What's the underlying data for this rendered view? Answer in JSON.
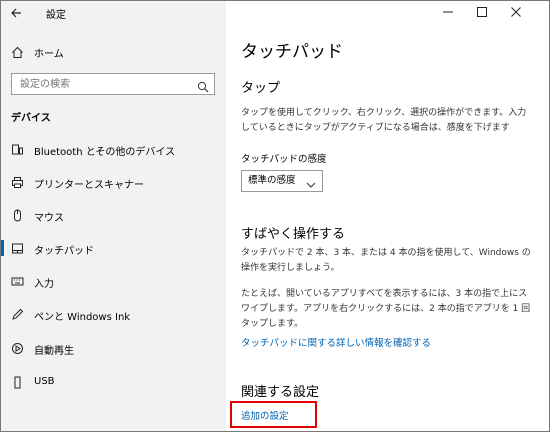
{
  "window": {
    "title": "設定",
    "controls": {
      "minimize": "—",
      "maximize": "☐",
      "close": "✕"
    }
  },
  "sidebar": {
    "home_label": "ホーム",
    "search_placeholder": "設定の検索",
    "section_label": "デバイス",
    "items": [
      {
        "label": "Bluetooth とその他のデバイス",
        "icon": "bluetooth-devices-icon"
      },
      {
        "label": "プリンターとスキャナー",
        "icon": "printer-icon"
      },
      {
        "label": "マウス",
        "icon": "mouse-icon"
      },
      {
        "label": "タッチパッド",
        "icon": "touchpad-icon",
        "active": true
      },
      {
        "label": "入力",
        "icon": "keyboard-icon"
      },
      {
        "label": "ペンと Windows Ink",
        "icon": "pen-icon"
      },
      {
        "label": "自動再生",
        "icon": "autoplay-icon"
      },
      {
        "label": "USB",
        "icon": "usb-icon"
      }
    ]
  },
  "main": {
    "title": "タッチパッド",
    "tap": {
      "heading": "タップ",
      "description": "タップを使用してクリック、右クリック、選択の操作ができます。入力しているときにタップがアクティブになる場合は、感度を下げます",
      "sensitivity_label": "タッチパッドの感度",
      "sensitivity_value": "標準の感度"
    },
    "quick": {
      "heading": "すばやく操作する",
      "description1": "タッチパッドで 2 本、3 本、または 4 本の指を使用して、Windows の操作を実行しましょう。",
      "description2": "たとえば、開いているアプリすべてを表示するには、3 本の指で上にスワイプします。アプリを右クリックするには、2 本の指でアプリを 1 回タップします。",
      "link": "タッチパッドに関する詳しい情報を確認する"
    },
    "related": {
      "heading": "関連する設定",
      "link": "追加の設定"
    }
  },
  "colors": {
    "accent": "#0063b1",
    "sidebar_bg": "#f2f2f2",
    "highlight": "#e30000"
  }
}
